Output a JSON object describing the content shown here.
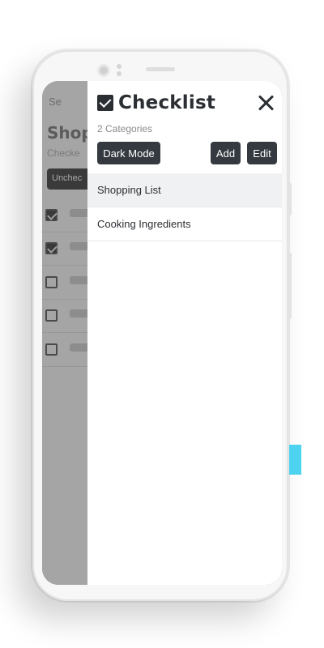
{
  "background_app": {
    "search_placeholder": "Se",
    "title": "Shop",
    "subtitle": "Checke",
    "filter_button": "Unchec",
    "rows": [
      {
        "checked": true
      },
      {
        "checked": true
      },
      {
        "checked": false
      },
      {
        "checked": false
      },
      {
        "checked": false
      }
    ]
  },
  "drawer": {
    "title": "Checklist",
    "category_count": "2 Categories",
    "buttons": {
      "dark_mode": "Dark Mode",
      "add": "Add",
      "edit": "Edit"
    },
    "categories": [
      {
        "label": "Shopping List",
        "active": true
      },
      {
        "label": "Cooking Ingredients",
        "active": false
      }
    ]
  },
  "colors": {
    "button_bg": "#353a40",
    "accent_tab": "#4dd2f0",
    "active_row": "#f0f1f2"
  }
}
